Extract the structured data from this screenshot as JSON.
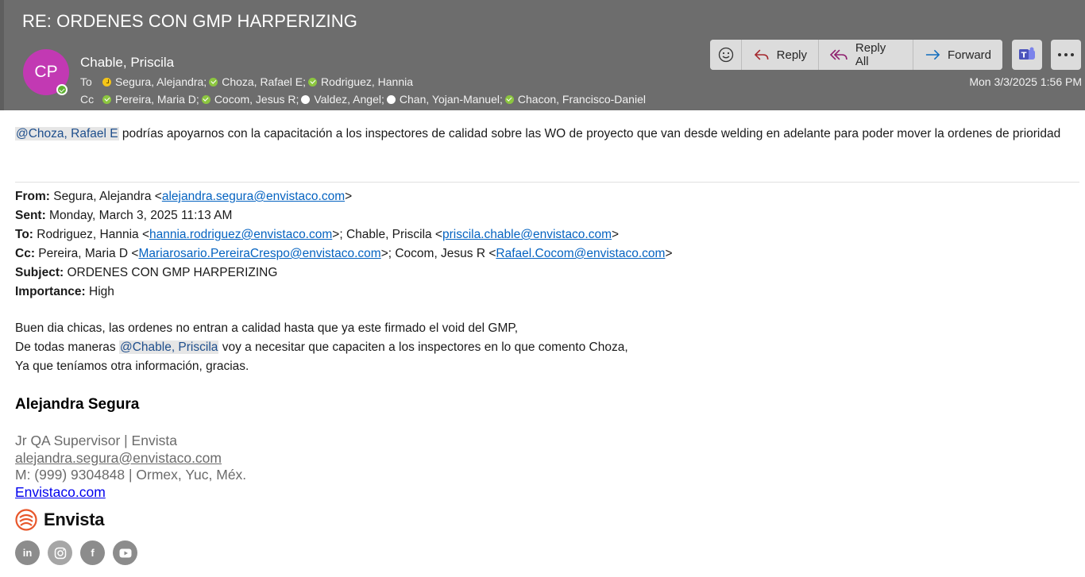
{
  "email": {
    "subject": "RE: ORDENES CON GMP HARPERIZING",
    "sender_initials": "CP",
    "sender_name": "Chable, Priscila",
    "to_label": "To",
    "cc_label": "Cc",
    "to": [
      {
        "name": "Segura, Alejandra;",
        "status": "away"
      },
      {
        "name": "Choza, Rafael E;",
        "status": "available"
      },
      {
        "name": "Rodriguez, Hannia",
        "status": "available"
      }
    ],
    "cc": [
      {
        "name": "Pereira, Maria D;",
        "status": "available"
      },
      {
        "name": "Cocom, Jesus R;",
        "status": "available"
      },
      {
        "name": "Valdez, Angel;",
        "status": "offline"
      },
      {
        "name": "Chan, Yojan-Manuel;",
        "status": "offline"
      },
      {
        "name": "Chacon, Francisco-Daniel",
        "status": "available"
      }
    ],
    "date": "Mon 3/3/2025 1:56 PM"
  },
  "actions": {
    "reply": "Reply",
    "reply_all": "Reply All",
    "forward": "Forward"
  },
  "body": {
    "mention1": "@Choza, Rafael E",
    "para1_rest": " podrías apoyarnos con la capacitación a los inspectores de calidad sobre las WO de proyecto que van desde welding en adelante para poder mover la ordenes de prioridad"
  },
  "quoted": {
    "from_label": "From:",
    "from_name": " Segura, Alejandra <",
    "from_email": "alejandra.segura@envistaco.com",
    "sent_label": "Sent:",
    "sent_value": " Monday, March 3, 2025 11:13 AM",
    "to_label": "To:",
    "to_name1": " Rodriguez, Hannia <",
    "to_email1": "hannia.rodriguez@envistaco.com",
    "to_name2": ">; Chable, Priscila <",
    "to_email2": "priscila.chable@envistaco.com",
    "cc_label": "Cc:",
    "cc_name1": " Pereira, Maria D <",
    "cc_email1": "Mariarosario.PereiraCrespo@envistaco.com",
    "cc_name2": ">; Cocom, Jesus R <",
    "cc_email2": "Rafael.Cocom@envistaco.com",
    "subject_label": "Subject:",
    "subject_value": " ORDENES CON GMP HARPERIZING",
    "importance_label": "Importance:",
    "importance_value": " High",
    "line1": "Buen dia chicas, las ordenes no entran a calidad hasta que ya este firmado el void del GMP,",
    "line2_pre": "De todas maneras ",
    "line2_mention": "@Chable, Priscila",
    "line2_post": " voy a necesitar que capaciten a los inspectores en lo que comento Choza,",
    "line3": "Ya que teníamos otra información, gracias."
  },
  "signature": {
    "name": "Alejandra Segura",
    "title": "Jr QA Supervisor | Envista",
    "email": "alejandra.segura@envistaco.com",
    "phone": "M: (999) 9304848 | Ormex, Yuc, Méx.",
    "website": "Envistaco.com",
    "brand": "Envista",
    "social": [
      "linkedin-icon",
      "instagram-icon",
      "facebook-icon",
      "youtube-icon"
    ]
  }
}
